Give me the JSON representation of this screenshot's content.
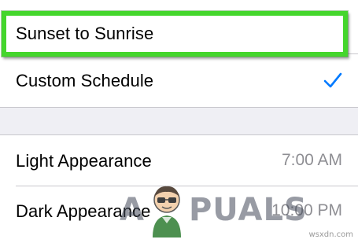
{
  "schedule_options": [
    {
      "label": "Sunset to Sunrise",
      "selected": false,
      "highlighted": true
    },
    {
      "label": "Custom Schedule",
      "selected": true,
      "highlighted": false
    }
  ],
  "times": [
    {
      "label": "Light Appearance",
      "value": "7:00 AM"
    },
    {
      "label": "Dark Appearance",
      "value": "10:00 PM"
    }
  ],
  "watermark": {
    "prefix": "A",
    "suffix": "PUALS"
  },
  "source_label": "wsxdn.com",
  "colors": {
    "highlight_border": "#44d62c",
    "checkmark": "#007aff",
    "secondary_text": "#8e8e93",
    "background": "#efeff4"
  },
  "icons": {
    "checkmark": "checkmark-icon",
    "watermark_mascot": "appuals-mascot-icon"
  }
}
